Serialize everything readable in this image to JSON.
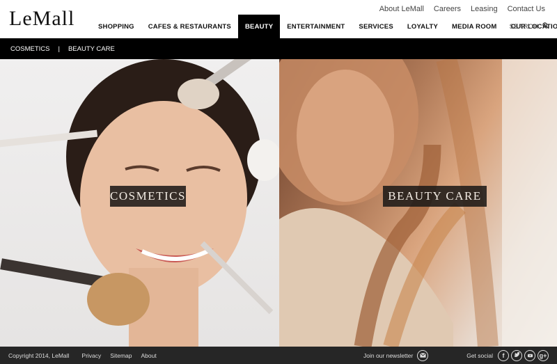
{
  "header": {
    "logo": "LeMall",
    "top_links": [
      "About LeMall",
      "Careers",
      "Leasing",
      "Contact Us"
    ],
    "nav": [
      "SHOPPING",
      "CAFES & RESTAURANTS",
      "BEAUTY",
      "ENTERTAINMENT",
      "SERVICES",
      "LOYALTY",
      "MEDIA ROOM",
      "OUR LOCATIONS"
    ],
    "active_nav": "BEAUTY",
    "search_label": "SEARCH"
  },
  "subnav": {
    "items": [
      "COSMETICS",
      "BEAUTY CARE"
    ],
    "separator": "|"
  },
  "panels": [
    {
      "label": "Cosmetics"
    },
    {
      "label": "Beauty Care"
    }
  ],
  "footer": {
    "copyright": "Copyright 2014, LeMall",
    "links": [
      "Privacy",
      "Sitemap",
      "About"
    ],
    "newsletter": "Join our newsletter",
    "social_label": "Get social",
    "social_icons": [
      "facebook-icon",
      "twitter-icon",
      "youtube-icon",
      "google-plus-icon"
    ]
  },
  "colors": {
    "nav_active_bg": "#000000",
    "subnav_bg": "#000000",
    "footer_bg": "#262626"
  }
}
